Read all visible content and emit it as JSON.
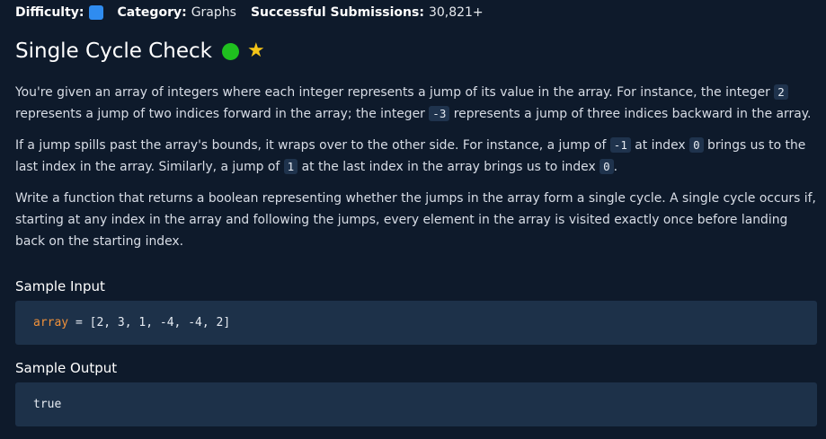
{
  "meta": {
    "difficulty_label": "Difficulty:",
    "category_label": "Category:",
    "category_value": "Graphs",
    "submissions_label": "Successful Submissions:",
    "submissions_value": "30,821+",
    "difficulty_color": "#2f8cf0"
  },
  "title": "Single Cycle Check",
  "title_status_icon": "green-dot",
  "title_favorite_icon": "star",
  "description": {
    "p1": {
      "t1": "You're given an array of integers where each integer represents a jump of its value in the array. For instance, the integer ",
      "c1": "2",
      "t2": " represents a jump of two indices forward in the array; the integer ",
      "c2": "-3",
      "t3": " represents a jump of three indices backward in the array."
    },
    "p2": {
      "t1": "If a jump spills past the array's bounds, it wraps over to the other side. For instance, a jump of ",
      "c1": "-1",
      "t2": " at index ",
      "c2": "0",
      "t3": " brings us to the last index in the array. Similarly, a jump of ",
      "c3": "1",
      "t4": " at the last index in the array brings us to index ",
      "c4": "0",
      "t5": "."
    },
    "p3": "Write a function that returns a boolean representing whether the jumps in the array form a single cycle. A single cycle occurs if, starting at any index in the array and following the jumps, every element in the array is visited exactly once before landing back on the starting index."
  },
  "sample_input": {
    "title": "Sample Input",
    "var_name": "array",
    "rest": " = [2, 3, 1, -4, -4, 2]"
  },
  "sample_output": {
    "title": "Sample Output",
    "value": "true"
  }
}
